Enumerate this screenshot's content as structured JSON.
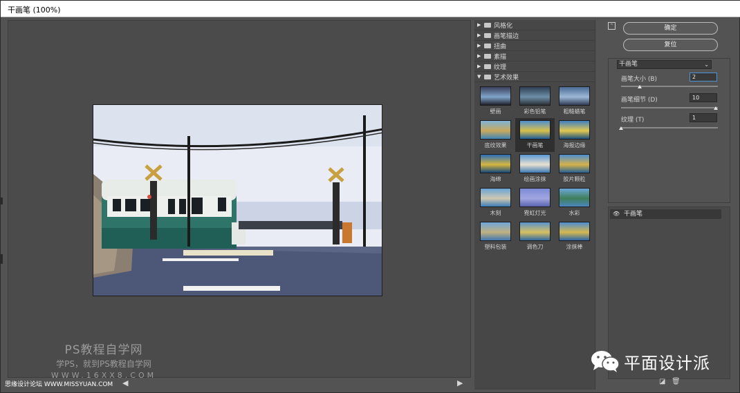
{
  "window": {
    "title": "干画笔 (100%)"
  },
  "preview": {
    "watermark": {
      "line1": "PS教程自学网",
      "line2": "学PS，就到PS教程自学网",
      "line3": "WWW.16XX8.COM"
    },
    "bottom_credit": "思缘设计论坛 WWW.MISSYUAN.COM",
    "scroll_left": "◀",
    "scroll_right": "▶"
  },
  "gallery": {
    "categories": [
      {
        "label": "风格化",
        "expanded": false
      },
      {
        "label": "画笔描边",
        "expanded": false
      },
      {
        "label": "扭曲",
        "expanded": false
      },
      {
        "label": "素描",
        "expanded": false
      },
      {
        "label": "纹理",
        "expanded": false
      },
      {
        "label": "艺术效果",
        "expanded": true
      }
    ],
    "collapsed_arrow": "▶",
    "expanded_arrow": "▼",
    "filters": [
      {
        "label": "壁画"
      },
      {
        "label": "彩色铅笔"
      },
      {
        "label": "粗糙蜡笔"
      },
      {
        "label": "底纹效果"
      },
      {
        "label": "干画笔"
      },
      {
        "label": "海报边缘"
      },
      {
        "label": "海绵"
      },
      {
        "label": "绘画涂抹"
      },
      {
        "label": "胶片颗粒"
      },
      {
        "label": "木刻"
      },
      {
        "label": "霓虹灯光"
      },
      {
        "label": "水彩"
      },
      {
        "label": "塑料包装"
      },
      {
        "label": "调色刀"
      },
      {
        "label": "涂抹棒"
      }
    ],
    "selected_filter": "干画笔"
  },
  "panel": {
    "ok_label": "确定",
    "reset_label": "复位",
    "collapse_glyph": "⌃",
    "filter_select": "干画笔",
    "select_chevron": "⌄",
    "params": [
      {
        "label": "画笔大小 (B)",
        "value": "2",
        "fraction": 0.2
      },
      {
        "label": "画笔细节 (D)",
        "value": "10",
        "fraction": 1.0
      },
      {
        "label": "纹理 (T)",
        "value": "1",
        "fraction": 0.0
      }
    ],
    "layer": {
      "eye_glyph": "👁",
      "name": "干画笔"
    },
    "new_layer_glyph": "◪",
    "delete_glyph": "🗑"
  },
  "brand": {
    "wechat_text": "平面设计派"
  },
  "colors": {
    "background": "#535353",
    "panel_dark": "#474747",
    "selected_thumb": "#2f2f2f",
    "active_field_border": "#4f93d8"
  }
}
